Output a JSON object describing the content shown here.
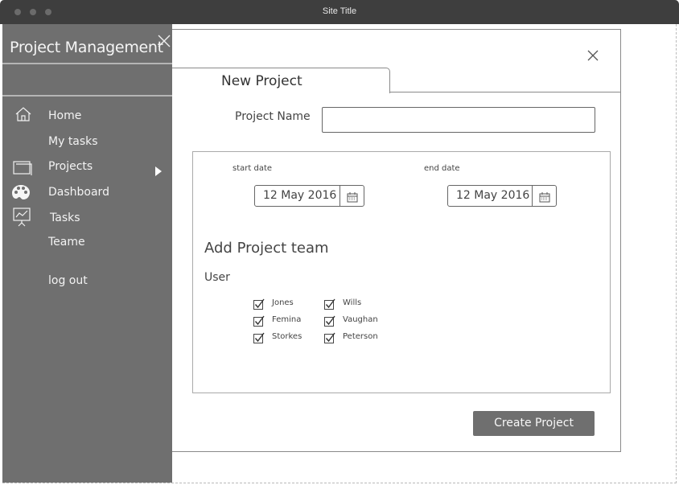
{
  "window": {
    "title": "Site Title"
  },
  "sidebar": {
    "title": "Project Management",
    "items": [
      {
        "label": "Home",
        "icon": "home-icon"
      },
      {
        "label": "My tasks",
        "icon": ""
      },
      {
        "label": "Projects",
        "icon": "window-icon"
      },
      {
        "label": "Dashboard",
        "icon": "palette-icon"
      },
      {
        "label": "Tasks",
        "icon": "presentation-icon"
      },
      {
        "label": "Teame",
        "icon": ""
      },
      {
        "label": "log out",
        "icon": ""
      }
    ]
  },
  "dialog": {
    "tab_label": "New Project",
    "project_name_label": "Project Name",
    "project_name_value": "",
    "start_date_label": "start date",
    "start_date_value": "12 May 2016",
    "end_date_label": "end date",
    "end_date_value": "12 May 2016",
    "team_title": "Add Project team",
    "user_label": "User",
    "users": [
      {
        "name": "Jones",
        "checked": true
      },
      {
        "name": "Femina",
        "checked": true
      },
      {
        "name": "Storkes",
        "checked": true
      },
      {
        "name": "Wills",
        "checked": true
      },
      {
        "name": "Vaughan",
        "checked": true
      },
      {
        "name": "Peterson",
        "checked": true
      }
    ],
    "create_button_label": "Create Project"
  },
  "colors": {
    "titlebar": "#3e3e3e",
    "sidebar": "#6f6f6f",
    "button": "#6f6f6f"
  }
}
